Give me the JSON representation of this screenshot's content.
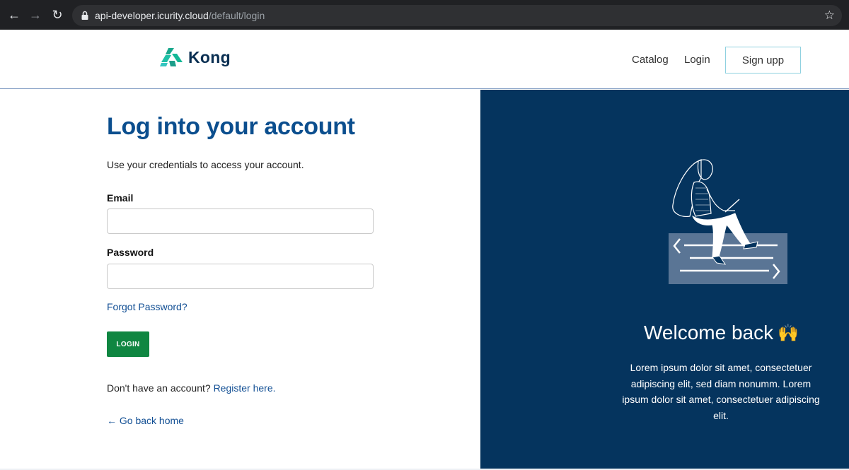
{
  "browser": {
    "url_host": "api-developer.icurity.cloud",
    "url_path": "/default/login"
  },
  "header": {
    "logo_text": "Kong",
    "nav": {
      "catalog": "Catalog",
      "login": "Login",
      "signup": "Sign upp"
    }
  },
  "form": {
    "title": "Log into your account",
    "subtitle": "Use your credentials to access your account.",
    "email_label": "Email",
    "email_value": "",
    "password_label": "Password",
    "password_value": "",
    "forgot_link": "Forgot Password?",
    "login_button": "LOGIN",
    "register_prompt": "Don't have an account?",
    "register_link": "Register here.",
    "go_home_link": "← Go back home"
  },
  "welcome": {
    "title": "Welcome back",
    "emoji": "🙌",
    "body": "Lorem ipsum dolor sit amet, consectetuer adipiscing elit, sed diam nonumm. Lorem ipsum dolor sit amet, consectetuer adipiscing elit."
  },
  "colors": {
    "brand_teal": "#1fb8a4",
    "title_blue": "#0b4e8e",
    "panel_navy": "#05345e",
    "login_green": "#0f8641"
  }
}
